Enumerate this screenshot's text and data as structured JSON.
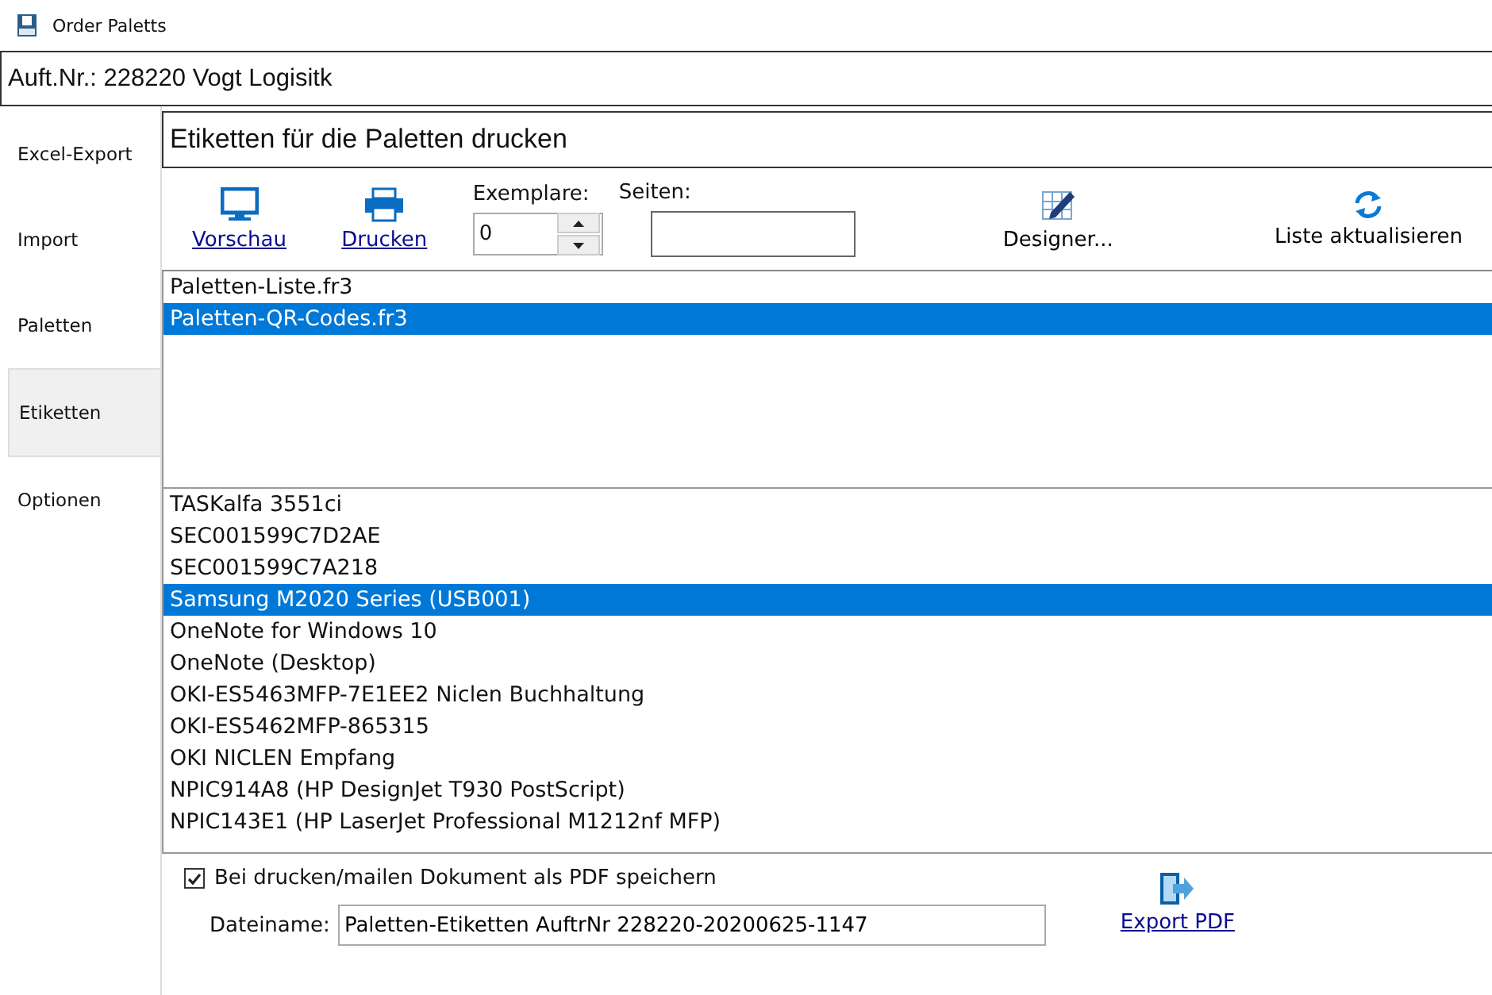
{
  "window": {
    "title": "Order Paletts"
  },
  "order_field": {
    "value": "Auft.Nr.: 228220 Vogt Logisitk"
  },
  "sidebar": {
    "items": [
      {
        "label": "Excel-Export",
        "selected": false
      },
      {
        "label": "Import",
        "selected": false
      },
      {
        "label": "Paletten",
        "selected": false
      },
      {
        "label": "Etiketten",
        "selected": true
      },
      {
        "label": "Optionen",
        "selected": false
      }
    ]
  },
  "heading": {
    "value": "Etiketten für die Paletten drucken"
  },
  "toolbar": {
    "preview": "Vorschau",
    "print": "Drucken",
    "copies_label": "Exemplare:",
    "copies_value": "0",
    "pages_label": "Seiten:",
    "designer": "Designer...",
    "refresh": "Liste aktualisieren"
  },
  "reports": [
    {
      "name": "Paletten-Liste.fr3",
      "selected": false
    },
    {
      "name": "Paletten-QR-Codes.fr3",
      "selected": true
    }
  ],
  "printers": [
    {
      "name": "TASKalfa 3551ci",
      "selected": false
    },
    {
      "name": "SEC001599C7D2AE",
      "selected": false
    },
    {
      "name": "SEC001599C7A218",
      "selected": false
    },
    {
      "name": "Samsung M2020 Series (USB001)",
      "selected": true
    },
    {
      "name": "OneNote for Windows 10",
      "selected": false
    },
    {
      "name": "OneNote (Desktop)",
      "selected": false
    },
    {
      "name": "OKI-ES5463MFP-7E1EE2 Niclen Buchhaltung",
      "selected": false
    },
    {
      "name": "OKI-ES5462MFP-865315",
      "selected": false
    },
    {
      "name": "OKI NICLEN Empfang",
      "selected": false
    },
    {
      "name": "NPIC914A8 (HP DesignJet T930 PostScript)",
      "selected": false
    },
    {
      "name": "NPIC143E1 (HP LaserJet Professional M1212nf MFP)",
      "selected": false
    }
  ],
  "pdf": {
    "save_label": "Bei drucken/mailen Dokument als PDF speichern",
    "checked": true,
    "filename_label": "Dateiname:",
    "filename": "Paletten-Etiketten AuftrNr 228220-20200625-1147",
    "export": "Export PDF"
  }
}
